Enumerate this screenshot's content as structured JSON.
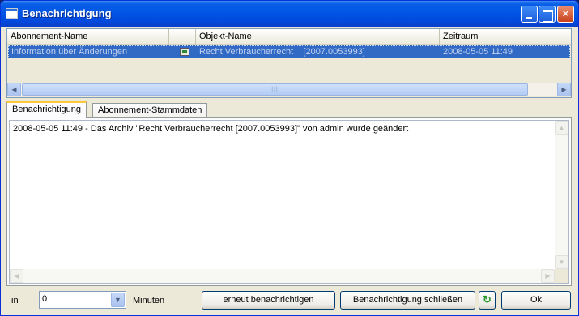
{
  "window": {
    "title": "Benachrichtigung",
    "controls": {
      "minimize": "",
      "maximize": "",
      "close": "✕"
    }
  },
  "grid": {
    "columns": [
      "Abonnement-Name",
      "",
      "Objekt-Name",
      "Zeitraum"
    ],
    "rows": [
      {
        "abonnement": "Information über Änderungen",
        "icon": "archive-icon",
        "objekt": "Recht Verbraucherrecht    [2007.0053993]",
        "zeitraum": "2008-05-05 11:49"
      }
    ],
    "scroll": {
      "left": "◀",
      "right": "▶",
      "grip": "|||"
    }
  },
  "tabs": [
    "Benachrichtigung",
    "Abonnement-Stammdaten"
  ],
  "message": "2008-05-05 11:49 - Das Archiv \"Recht Verbraucherrecht [2007.0053993]\" von admin wurde geändert",
  "textarea_scroll": {
    "up": "▲",
    "down": "▼",
    "left": "◀",
    "right": "▶"
  },
  "footer": {
    "in_label": "in",
    "interval_value": "0",
    "combo_arrow": "▼",
    "minutes_label": "Minuten",
    "renotify_label": "erneut benachrichtigen",
    "close_notification_label": "Benachrichtigung schließen",
    "refresh_glyph": "↻",
    "ok_label": "Ok"
  },
  "colors": {
    "titlebar": "#0055e5",
    "selection": "#316ac5",
    "window_bg": "#ece9d8"
  }
}
